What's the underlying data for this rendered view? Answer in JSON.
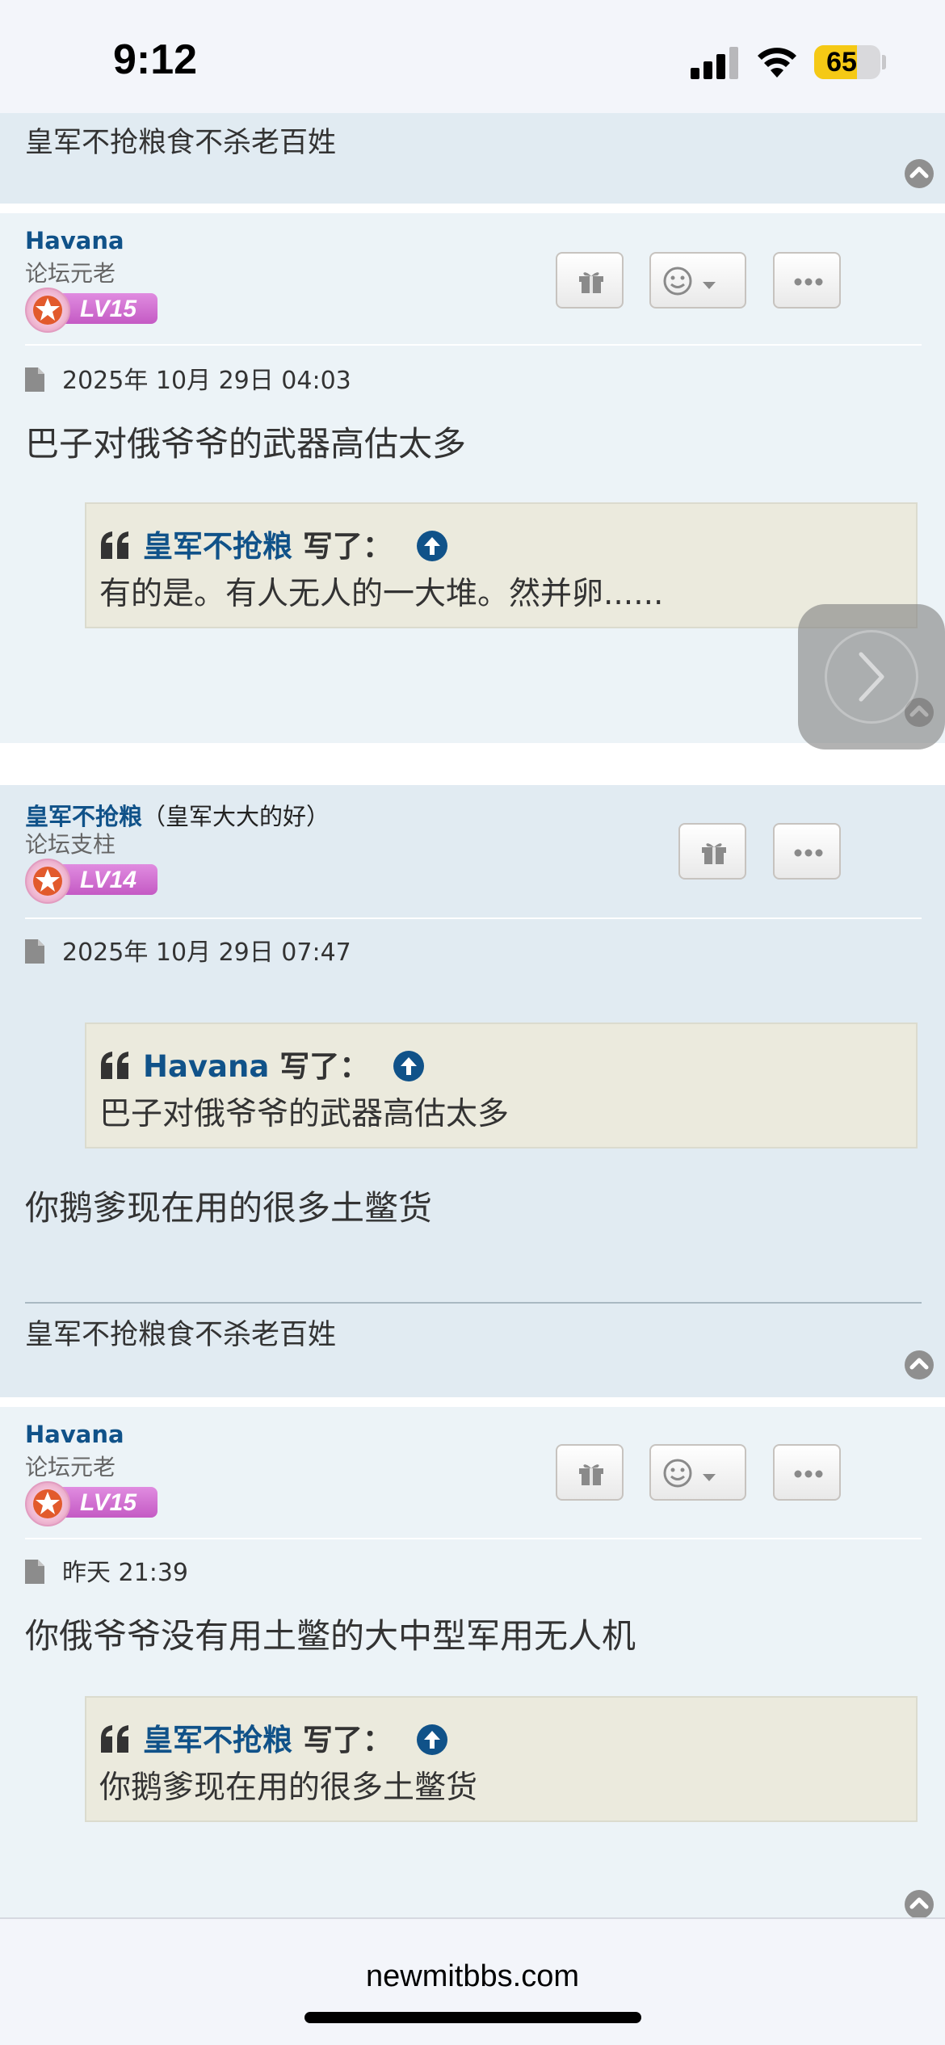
{
  "status_bar": {
    "time": "9:12",
    "battery": "65",
    "signal_bars_active": 3,
    "signal_bars_total": 4
  },
  "top_fragment": {
    "signature": "皇军不抢粮食不杀老百姓"
  },
  "posts": [
    {
      "author": "Havana",
      "nickname": "",
      "rank": "论坛元老",
      "level": "LV15",
      "date": "2025年 10月 29日 04:03",
      "body": "巴子对俄爷爷的武器高估太多",
      "quote": {
        "author": "皇军不抢粮",
        "wrote": "写了：",
        "text": "有的是。有人无人的一大堆。然并卵......"
      },
      "buttons": [
        "gift-icon",
        "reaction-icon",
        "more-icon"
      ]
    },
    {
      "author": "皇军不抢粮",
      "nickname": "（皇军大大的好）",
      "rank": "论坛支柱",
      "level": "LV14",
      "date": "2025年 10月 29日 07:47",
      "quote": {
        "author": "Havana",
        "wrote": "写了：",
        "text": "巴子对俄爷爷的武器高估太多"
      },
      "body": "你鹅爹现在用的很多土鳖货",
      "signature": "皇军不抢粮食不杀老百姓",
      "buttons": [
        "gift-icon",
        "more-icon"
      ]
    },
    {
      "author": "Havana",
      "nickname": "",
      "rank": "论坛元老",
      "level": "LV15",
      "date": "昨天 21:39",
      "body": "你俄爷爷没有用土鳖的大中型军用无人机",
      "quote": {
        "author": "皇军不抢粮",
        "wrote": "写了：",
        "text": "你鹅爹现在用的很多土鳖货"
      },
      "buttons": [
        "gift-icon",
        "reaction-icon",
        "more-icon"
      ]
    }
  ],
  "url_bar": {
    "domain": "newmitbbs.com"
  },
  "colors": {
    "post_bg_dark": "#e1ebf2",
    "post_bg_light": "#ecf3f7",
    "username": "#105289",
    "quote_bg": "#ebeadd",
    "battery_fill": "#f5c915"
  }
}
